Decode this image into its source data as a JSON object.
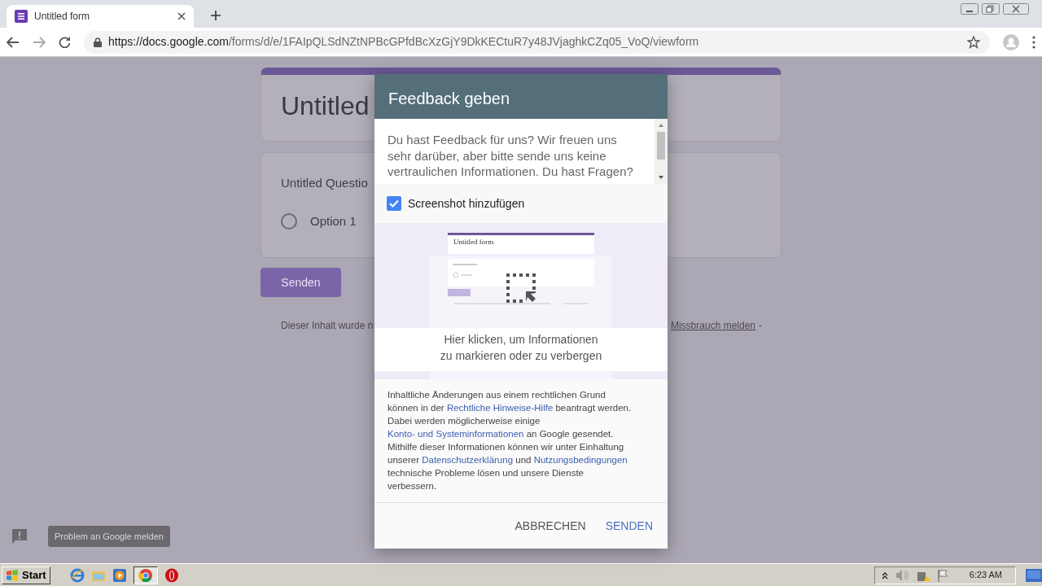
{
  "browser": {
    "tab": {
      "title": "Untitled form",
      "selected": true
    },
    "address": {
      "host": "https://docs.google.com",
      "path": "/forms/d/e/1FAIpQLSdNZtNPBcGPfdBcXzGjY9DkKECtuR7y48JVjaghkCZq05_VoQ/viewform"
    }
  },
  "form": {
    "title": "Untitled",
    "question": "Untitled Questio",
    "options": [
      {
        "label": "Option 1",
        "selected": false
      }
    ],
    "submit": "Senden",
    "footer_left": "Dieser Inhalt wurde n",
    "footer_link": "Missbrauch melden",
    "footer_right": "-"
  },
  "dialog": {
    "title": "Feedback geben",
    "placeholder": "Du hast Feedback für uns? Wir freuen uns sehr darüber, aber bitte sende uns keine vertraulichen Informationen. Du hast Fragen?",
    "screenshot_checkbox": {
      "label": "Screenshot hinzufügen",
      "checked": true
    },
    "preview": {
      "form_title": "Untitled form",
      "hint": "Hier klicken, um Informationen zu markieren oder zu verbergen"
    },
    "legal": [
      {
        "kind": "text",
        "text": "Inhaltliche Änderungen aus einem rechtlichen Grund können in der "
      },
      {
        "kind": "link",
        "text": "Rechtliche Hinweise-Hilfe"
      },
      {
        "kind": "text",
        "text": " beantragt werden. Dabei werden möglicherweise einige "
      },
      {
        "kind": "link",
        "text": "Konto- und Systeminformationen"
      },
      {
        "kind": "text",
        "text": " an Google gesendet. Mithilfe dieser Informationen können wir unter Einhaltung unserer "
      },
      {
        "kind": "link",
        "text": "Datenschutzerklärung"
      },
      {
        "kind": "text",
        "text": " und "
      },
      {
        "kind": "link",
        "text": "Nutzungsbedingungen"
      },
      {
        "kind": "text",
        "text": " technische Probleme lösen und unsere Dienste verbessern."
      }
    ],
    "buttons": [
      {
        "label": "ABBRECHEN",
        "kind": "secondary"
      },
      {
        "label": "SENDEN",
        "kind": "primary"
      }
    ]
  },
  "report_tooltip": "Problem an Google melden",
  "taskbar": {
    "start": "Start",
    "clock": "6:23 AM"
  }
}
